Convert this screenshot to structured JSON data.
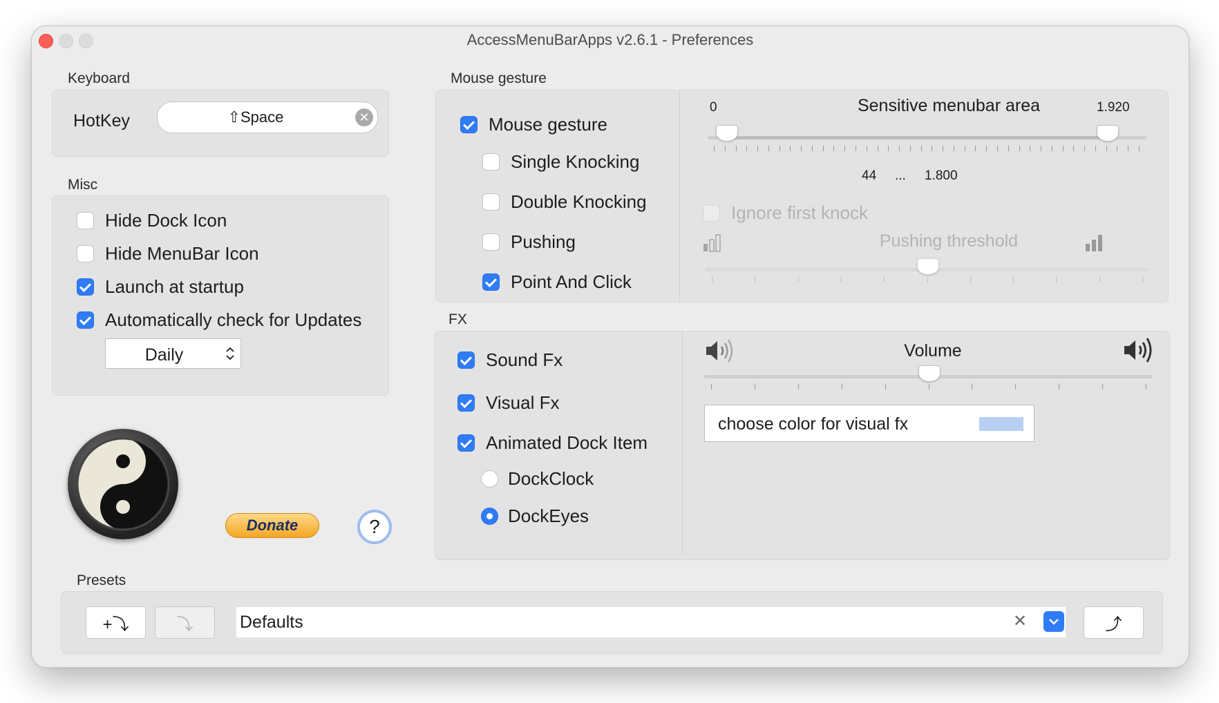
{
  "window": {
    "title": "AccessMenuBarApps v2.6.1 - Preferences"
  },
  "keyboard": {
    "section_label": "Keyboard",
    "hotkey_label": "HotKey",
    "hotkey_value": "⇧Space"
  },
  "misc": {
    "section_label": "Misc",
    "items": [
      {
        "label": "Hide Dock Icon",
        "checked": false
      },
      {
        "label": "Hide MenuBar Icon",
        "checked": false
      },
      {
        "label": "Launch at startup",
        "checked": true
      },
      {
        "label": "Automatically check for Updates",
        "checked": true
      }
    ],
    "update_frequency": "Daily"
  },
  "logo": {
    "icon": "yin-yang-icon"
  },
  "donate_button": "Donate",
  "help_button": "?",
  "mouse_gesture": {
    "section_label": "Mouse gesture",
    "items": [
      {
        "label": "Mouse gesture",
        "checked": true
      },
      {
        "label": "Single Knocking",
        "checked": false
      },
      {
        "label": "Double Knocking",
        "checked": false
      },
      {
        "label": "Pushing",
        "checked": false
      },
      {
        "label": "Point And Click",
        "checked": true
      }
    ],
    "sensitive_area": {
      "title": "Sensitive menubar area",
      "min_label": "0",
      "max_label": "1.920",
      "low_value": "44",
      "separator": "...",
      "high_value": "1.800"
    },
    "ignore_first_knock": {
      "label": "Ignore first knock",
      "checked": false,
      "enabled": false
    },
    "pushing_threshold": {
      "label": "Pushing threshold",
      "value": 0.5,
      "enabled": false
    }
  },
  "fx": {
    "section_label": "FX",
    "items": [
      {
        "label": "Sound Fx",
        "checked": true
      },
      {
        "label": "Visual Fx",
        "checked": true
      },
      {
        "label": "Animated Dock Item",
        "checked": true
      }
    ],
    "dock_options": [
      {
        "label": "DockClock",
        "selected": false
      },
      {
        "label": "DockEyes",
        "selected": true
      }
    ],
    "volume": {
      "label": "Volume",
      "value": 0.5
    },
    "color_button": {
      "label": "choose color for visual fx",
      "color": "#b7d0f2"
    }
  },
  "presets": {
    "section_label": "Presets",
    "add_button": "+⤵",
    "apply_button": "⤵",
    "current": "Defaults",
    "export_button": "⤴"
  },
  "colors": {
    "accent": "#2f7cf6",
    "close": "#ff5f57"
  }
}
